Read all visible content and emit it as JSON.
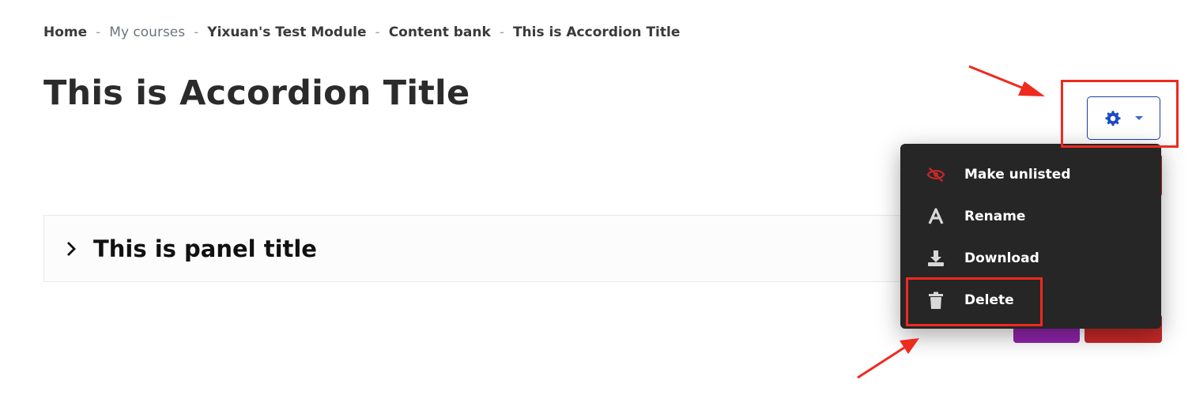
{
  "breadcrumb": {
    "items": [
      "Home",
      "My courses",
      "Yixuan's Test Module",
      "Content bank",
      "This is Accordion Title"
    ],
    "separator": "-"
  },
  "page": {
    "title": "This is Accordion Title"
  },
  "toolbar": {
    "settings_icon": "gear-icon",
    "dropdown_icon": "caret-down-icon"
  },
  "accordion": {
    "panel_title": "This is panel title",
    "toggle_icon": "chevron-right-icon"
  },
  "menu": {
    "items": [
      {
        "label": "Make unlisted",
        "icon": "eye-slash-icon"
      },
      {
        "label": "Rename",
        "icon": "font-a-icon"
      },
      {
        "label": "Download",
        "icon": "download-icon"
      },
      {
        "label": "Delete",
        "icon": "trash-icon"
      }
    ]
  },
  "colors": {
    "accent_blue": "#1f3f9e",
    "menu_bg": "#262626",
    "unlisted_icon_red": "#c62828",
    "highlight_red": "#ef2a1f",
    "button_purple": "#8e24aa",
    "button_red": "#c62828"
  }
}
